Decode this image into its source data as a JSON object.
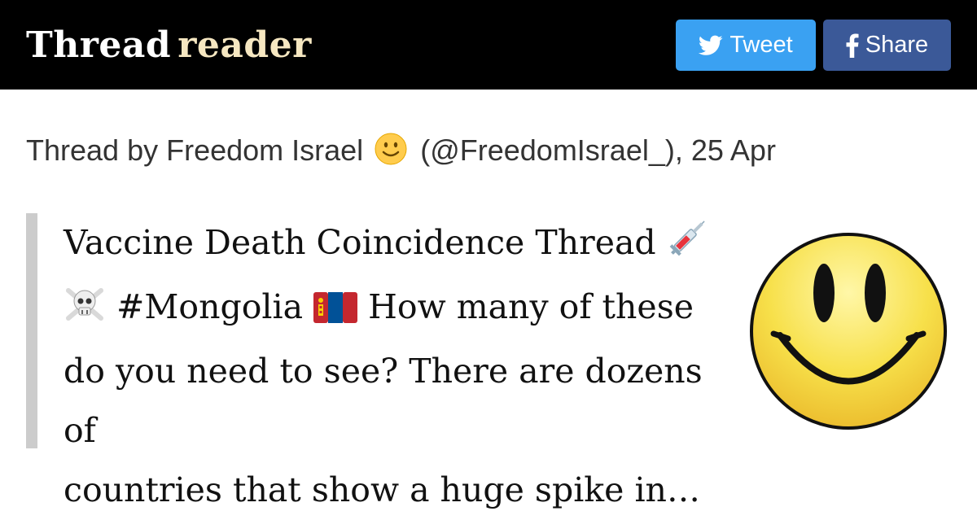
{
  "header": {
    "logo_word1": "Thread",
    "logo_word2": "reader",
    "tweet_label": "Tweet",
    "share_label": "Share"
  },
  "byline": {
    "prefix": "Thread by Freedom Israel",
    "handle": "(@FreedomIsrael_), 25 Apr"
  },
  "tweet": {
    "line1": "Vaccine Death Coincidence Thread",
    "line2_text": "#Mongolia",
    "line2_rest": "How many of these",
    "line3": "do you need to see? There are dozens of",
    "line4": "countries that show a huge spike in…"
  },
  "icons": {
    "tweet": "twitter-bird-icon",
    "share": "facebook-f-icon",
    "byline_emoji": "slightly-smiling-face-icon",
    "line1_emoji": "syringe-icon",
    "line2_emoji1": "skull-and-crossbones-icon",
    "line2_emoji2": "mongolia-flag-icon"
  },
  "colors": {
    "topbar": "#000000",
    "tweet_button": "#3aa1f2",
    "share_button": "#3b5998",
    "logo_accent": "#f6e7c1",
    "quote_bar": "#cccccc"
  }
}
